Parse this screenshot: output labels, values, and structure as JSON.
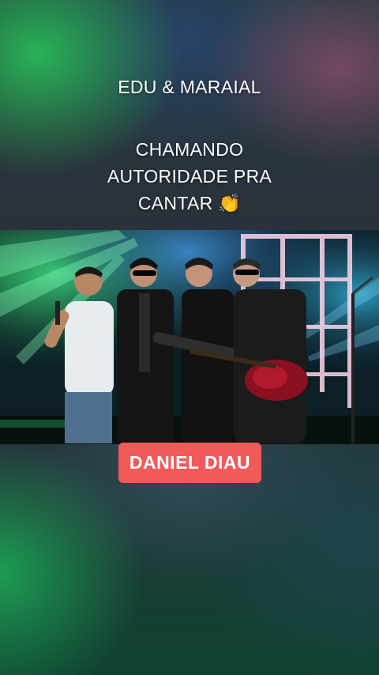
{
  "caption": {
    "title": "EDU & MARAIAL",
    "lines": [
      "CHAMANDO",
      "AUTORIDADE PRA",
      "CANTAR 👏"
    ]
  },
  "video": {
    "icon": "concert-stage-photo"
  },
  "badge": {
    "name": "DANIEL DIAU",
    "color": "#f15a5a"
  }
}
